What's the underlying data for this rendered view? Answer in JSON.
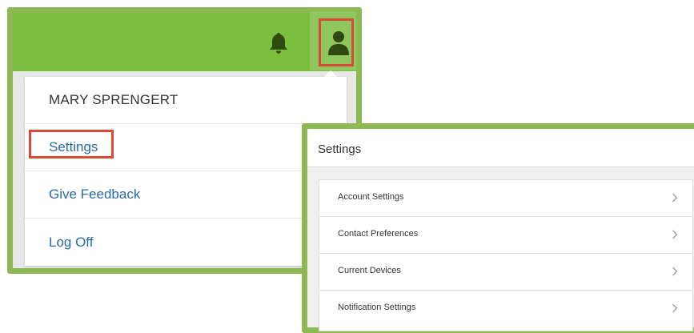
{
  "user_menu": {
    "user_name": "MARY SPRENGERT",
    "items": [
      {
        "label": "Settings"
      },
      {
        "label": "Give Feedback"
      },
      {
        "label": "Log Off"
      }
    ],
    "header_icons": [
      "bell-icon",
      "user-icon"
    ]
  },
  "settings_page": {
    "title": "Settings",
    "items": [
      {
        "label": "Account Settings"
      },
      {
        "label": "Contact Preferences"
      },
      {
        "label": "Current Devices"
      },
      {
        "label": "Notification Settings"
      }
    ]
  },
  "colors": {
    "header_green": "#7cbe3e",
    "frame_green": "#8db954",
    "highlight_red": "#d94b37",
    "link_blue": "#2a6ba6"
  }
}
